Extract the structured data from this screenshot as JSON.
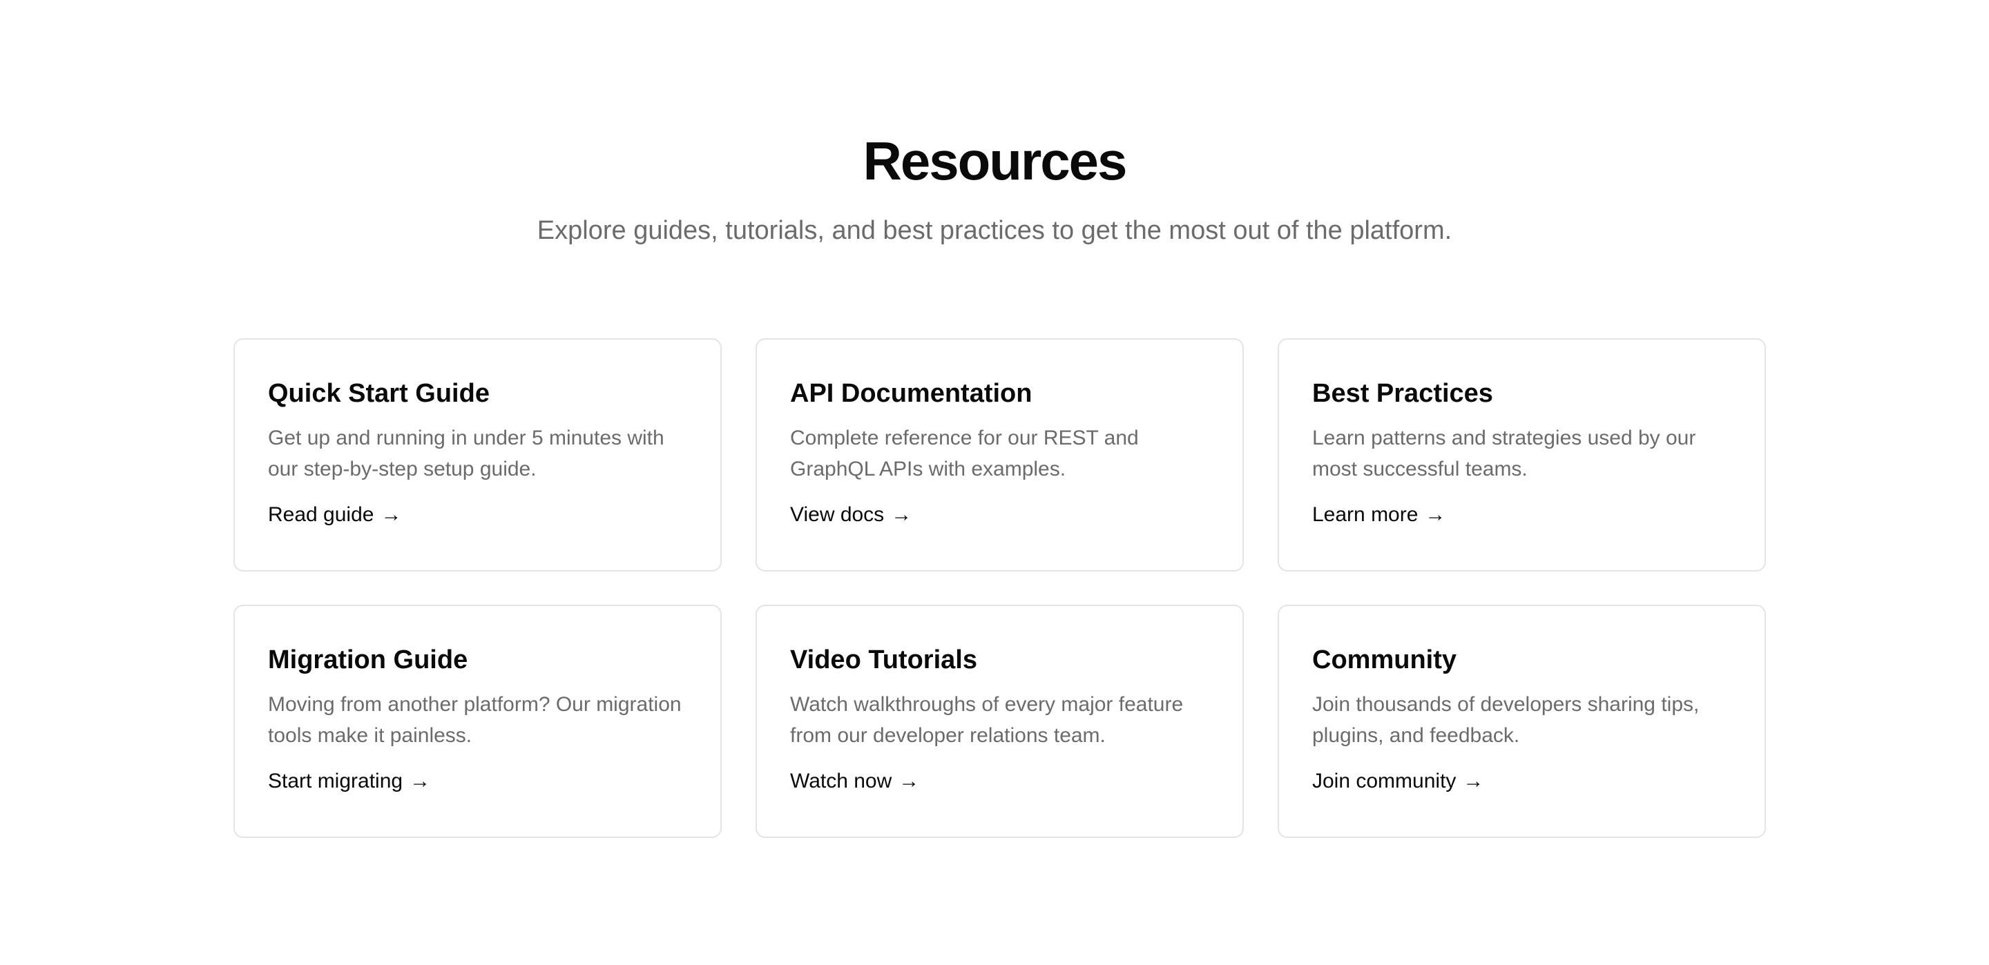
{
  "header": {
    "title": "Resources",
    "subtitle": "Explore guides, tutorials, and best practices to get the most out of the platform."
  },
  "cards": [
    {
      "title": "Quick Start Guide",
      "description": "Get up and running in under 5 minutes with our step-by-step setup guide.",
      "link": "Read guide",
      "icon": "arrow-right-icon"
    },
    {
      "title": "API Documentation",
      "description": "Complete reference for our REST and GraphQL APIs with examples.",
      "link": "View docs",
      "icon": "arrow-right-icon"
    },
    {
      "title": "Best Practices",
      "description": "Learn patterns and strategies used by our most successful teams.",
      "link": "Learn more",
      "icon": "arrow-right-icon"
    },
    {
      "title": "Migration Guide",
      "description": "Moving from another platform? Our migration tools make it painless.",
      "link": "Start migrating",
      "icon": "arrow-right-icon"
    },
    {
      "title": "Video Tutorials",
      "description": "Watch walkthroughs of every major feature from our developer relations team.",
      "link": "Watch now",
      "icon": "arrow-right-icon"
    },
    {
      "title": "Community",
      "description": "Join thousands of developers sharing tips, plugins, and feedback.",
      "link": "Join community",
      "icon": "arrow-right-icon"
    }
  ],
  "colors": {
    "heading": "#0a0a0a",
    "muted_text": "#6b6b6b",
    "card_border": "#e4e4e4",
    "background": "#ffffff"
  }
}
